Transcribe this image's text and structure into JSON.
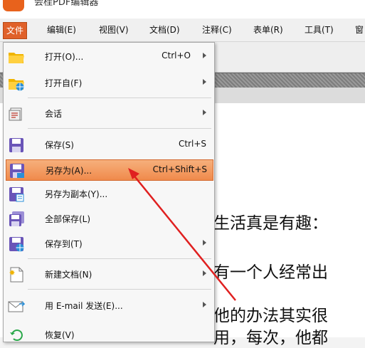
{
  "app": {
    "title": "会桂PDF编辑器"
  },
  "menubar": {
    "items": [
      "文件",
      "编辑(E)",
      "视图(V)",
      "文档(D)",
      "注释(C)",
      "表单(R)",
      "工具(T)",
      "窗"
    ]
  },
  "file_menu": {
    "items": [
      {
        "label": "打开(O)...",
        "shortcut": "Ctrl+O",
        "submenu": true,
        "icon": "folder-open-icon"
      },
      {
        "label": "打开自(F)",
        "shortcut": "",
        "submenu": true,
        "icon": "folder-globe-icon"
      },
      {
        "label": "会话",
        "shortcut": "",
        "submenu": true,
        "icon": "session-icon"
      },
      {
        "label": "保存(S)",
        "shortcut": "Ctrl+S",
        "submenu": false,
        "icon": "floppy-icon"
      },
      {
        "label": "另存为(A)...",
        "shortcut": "Ctrl+Shift+S",
        "submenu": false,
        "icon": "floppy-save-as-icon",
        "highlighted": true
      },
      {
        "label": "另存为副本(Y)...",
        "shortcut": "",
        "submenu": false,
        "icon": "floppy-copy-icon"
      },
      {
        "label": "全部保存(L)",
        "shortcut": "",
        "submenu": false,
        "icon": "floppy-all-icon"
      },
      {
        "label": "保存到(T)",
        "shortcut": "",
        "submenu": true,
        "icon": "floppy-globe-icon"
      },
      {
        "label": "新建文档(N)",
        "shortcut": "",
        "submenu": true,
        "icon": "new-document-icon"
      },
      {
        "label": "用 E-mail 发送(E)...",
        "shortcut": "",
        "submenu": true,
        "icon": "email-icon"
      },
      {
        "label": "恢复(V)",
        "shortcut": "",
        "submenu": false,
        "icon": "revert-icon"
      }
    ]
  },
  "document": {
    "lines": [
      "生活真是有趣：",
      "有一个人经常出",
      "他的办法其实很",
      "用，每次，他都"
    ]
  },
  "colors": {
    "accent": "#e0612a",
    "highlight": "#f08a4c",
    "annotation_arrow": "#e02020"
  }
}
